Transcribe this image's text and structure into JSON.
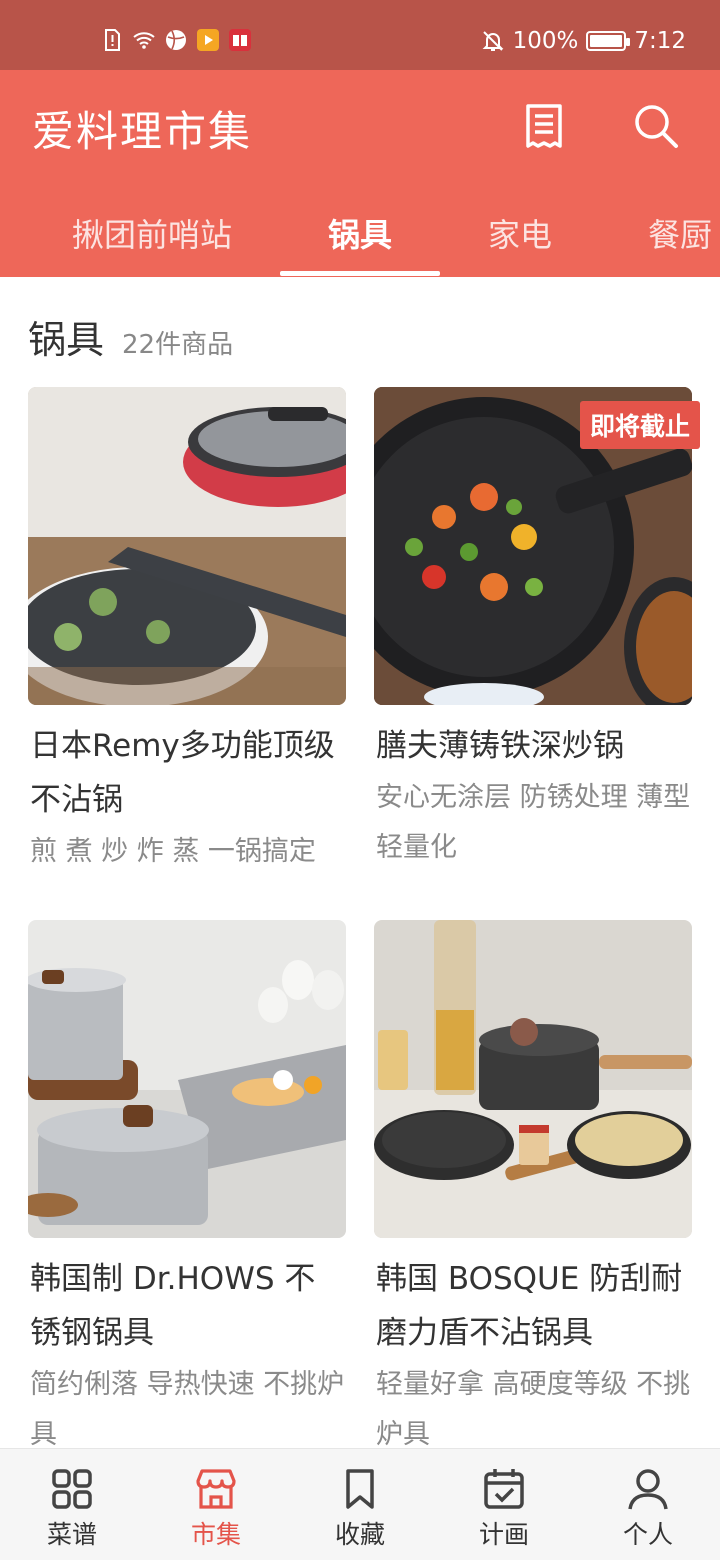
{
  "status_bar": {
    "battery": "100%",
    "time": "7:12",
    "battery_level": 1.0
  },
  "header": {
    "title": "爱料理市集",
    "receipt_icon": "receipt-icon",
    "search_icon": "search-icon"
  },
  "tabs": [
    {
      "label": "揪团前哨站"
    },
    {
      "label": "锅具"
    },
    {
      "label": "家电"
    },
    {
      "label": "餐厨"
    }
  ],
  "section": {
    "title": "锅具",
    "count": "22件商品"
  },
  "products": [
    {
      "title": "日本Remy多功能顶级不沾锅",
      "subtitle": "煎 煮 炒 炸 蒸 一锅搞定",
      "badge": ""
    },
    {
      "title": "膳夫薄铸铁深炒锅",
      "subtitle": "安心无涂层 防锈处理 薄型轻量化",
      "badge": "即将截止"
    },
    {
      "title": "韩国制 Dr.HOWS 不锈钢锅具",
      "subtitle": "简约俐落 导热快速 不挑炉具",
      "badge": ""
    },
    {
      "title": "韩国 BOSQUE 防刮耐磨力盾不沾锅具",
      "subtitle": "轻量好拿 高硬度等级 不挑炉具",
      "badge": ""
    }
  ],
  "bottom_nav": [
    {
      "label": "菜谱",
      "icon": "grid-icon"
    },
    {
      "label": "市集",
      "icon": "store-icon"
    },
    {
      "label": "收藏",
      "icon": "bookmark-icon"
    },
    {
      "label": "计画",
      "icon": "calendar-icon"
    },
    {
      "label": "个人",
      "icon": "person-icon"
    }
  ],
  "colors": {
    "status_bar": "#b85449",
    "header": "#ee6759",
    "accent": "#e4544a"
  }
}
